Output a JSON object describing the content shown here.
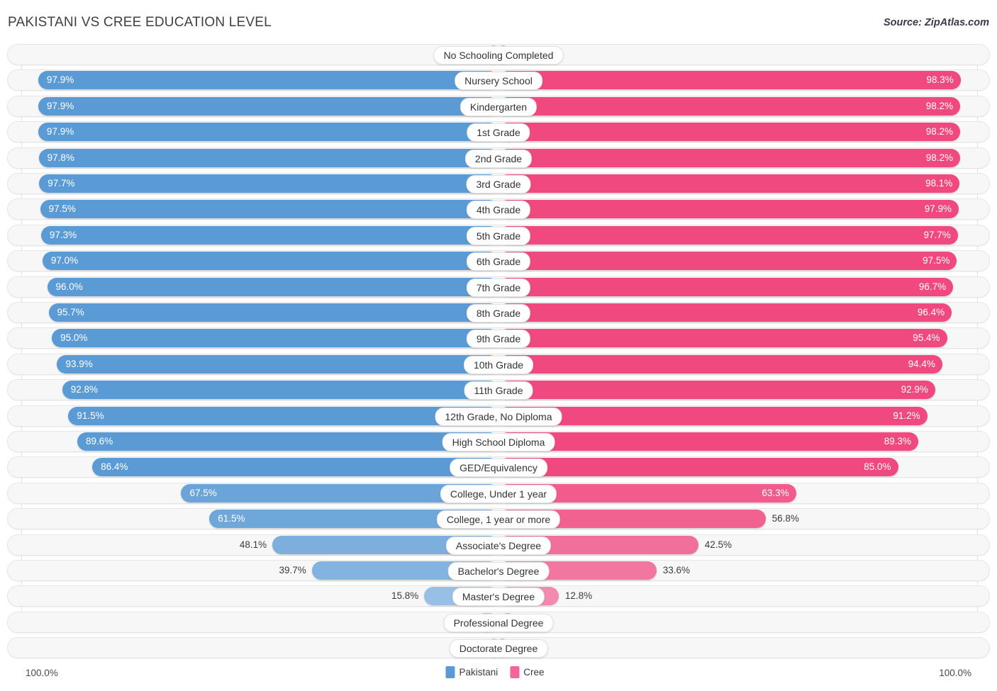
{
  "header": {
    "title": "PAKISTANI VS CREE EDUCATION LEVEL",
    "source": "Source: ZipAtlas.com"
  },
  "footer": {
    "axis_left": "100.0%",
    "axis_right": "100.0%"
  },
  "legend": [
    {
      "label": "Pakistani",
      "color": "#5b9bd5"
    },
    {
      "label": "Cree",
      "color": "#f4649a"
    }
  ],
  "colors": {
    "pakistani_strong": "#5b9bd5",
    "pakistani_light": "#a6c8ea",
    "cree_strong": "#f0497f",
    "cree_light": "#f294b6",
    "track": "#f7f7f7",
    "track_border": "#e6e6e6"
  },
  "chart_data": {
    "type": "bar",
    "title": "PAKISTANI VS CREE EDUCATION LEVEL",
    "subtitle": "Source: ZipAtlas.com",
    "orientation": "horizontal-diverging",
    "xlabel": "",
    "ylabel": "",
    "xlim": [
      0,
      100
    ],
    "grid": true,
    "legend_position": "bottom-center",
    "axis_max_label": "100.0%",
    "categories": [
      "No Schooling Completed",
      "Nursery School",
      "Kindergarten",
      "1st Grade",
      "2nd Grade",
      "3rd Grade",
      "4th Grade",
      "5th Grade",
      "6th Grade",
      "7th Grade",
      "8th Grade",
      "9th Grade",
      "10th Grade",
      "11th Grade",
      "12th Grade, No Diploma",
      "High School Diploma",
      "GED/Equivalency",
      "College, Under 1 year",
      "College, 1 year or more",
      "Associate's Degree",
      "Bachelor's Degree",
      "Master's Degree",
      "Professional Degree",
      "Doctorate Degree"
    ],
    "series": [
      {
        "name": "Pakistani",
        "color": "#5b9bd5",
        "values": [
          2.1,
          97.9,
          97.9,
          97.9,
          97.8,
          97.7,
          97.5,
          97.3,
          97.0,
          96.0,
          95.7,
          95.0,
          93.9,
          92.8,
          91.5,
          89.6,
          86.4,
          67.5,
          61.5,
          48.1,
          39.7,
          15.8,
          4.8,
          2.0
        ],
        "labels": [
          "2.1%",
          "97.9%",
          "97.9%",
          "97.9%",
          "97.8%",
          "97.7%",
          "97.5%",
          "97.3%",
          "97.0%",
          "96.0%",
          "95.7%",
          "95.0%",
          "93.9%",
          "92.8%",
          "91.5%",
          "89.6%",
          "86.4%",
          "67.5%",
          "61.5%",
          "48.1%",
          "39.7%",
          "15.8%",
          "4.8%",
          "2.0%"
        ]
      },
      {
        "name": "Cree",
        "color": "#f0497f",
        "values": [
          1.9,
          98.3,
          98.2,
          98.2,
          98.2,
          98.1,
          97.9,
          97.7,
          97.5,
          96.7,
          96.4,
          95.4,
          94.4,
          92.9,
          91.2,
          89.3,
          85.0,
          63.3,
          56.8,
          42.5,
          33.6,
          12.8,
          3.9,
          1.6
        ],
        "labels": [
          "1.9%",
          "98.3%",
          "98.2%",
          "98.2%",
          "98.2%",
          "98.1%",
          "97.9%",
          "97.7%",
          "97.5%",
          "96.7%",
          "96.4%",
          "95.4%",
          "94.4%",
          "92.9%",
          "91.2%",
          "89.3%",
          "85.0%",
          "63.3%",
          "56.8%",
          "42.5%",
          "33.6%",
          "12.8%",
          "3.9%",
          "1.6%"
        ]
      }
    ]
  }
}
